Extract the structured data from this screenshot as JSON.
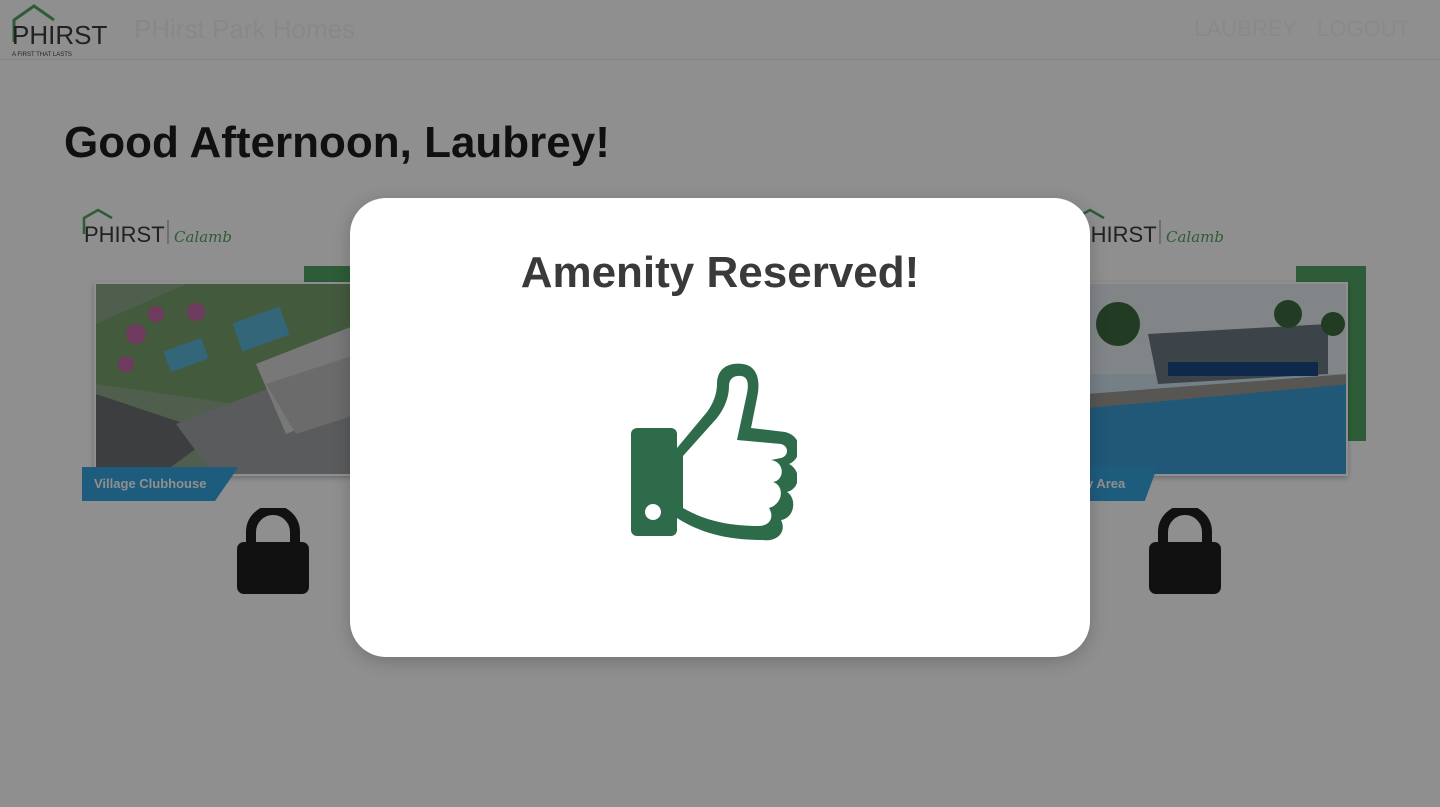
{
  "header": {
    "logo_text": "PHIRST",
    "logo_tagline": "A FIRST THAT LASTS",
    "title": "PHirst Park Homes",
    "user_link": "LAUBREY",
    "logout_link": "LOGOUT"
  },
  "main": {
    "greeting": "Good Afternoon, Laubrey!",
    "cards": [
      {
        "logo_text": "PHIRST",
        "location": "Calamba",
        "label": "Village Clubhouse",
        "locked": true
      },
      {
        "logo_text": "PHIRST",
        "location": "Calamba",
        "label": "y Area",
        "locked": true
      }
    ]
  },
  "modal": {
    "title": "Amenity Reserved!",
    "icon": "thumbs-up-icon",
    "icon_color": "#2e6b4a"
  },
  "colors": {
    "overlay": "rgba(0,0,0,0.44)",
    "brand_green": "#52a565",
    "label_blue": "#36a4e0",
    "lock_dark": "#1f1f1f"
  }
}
